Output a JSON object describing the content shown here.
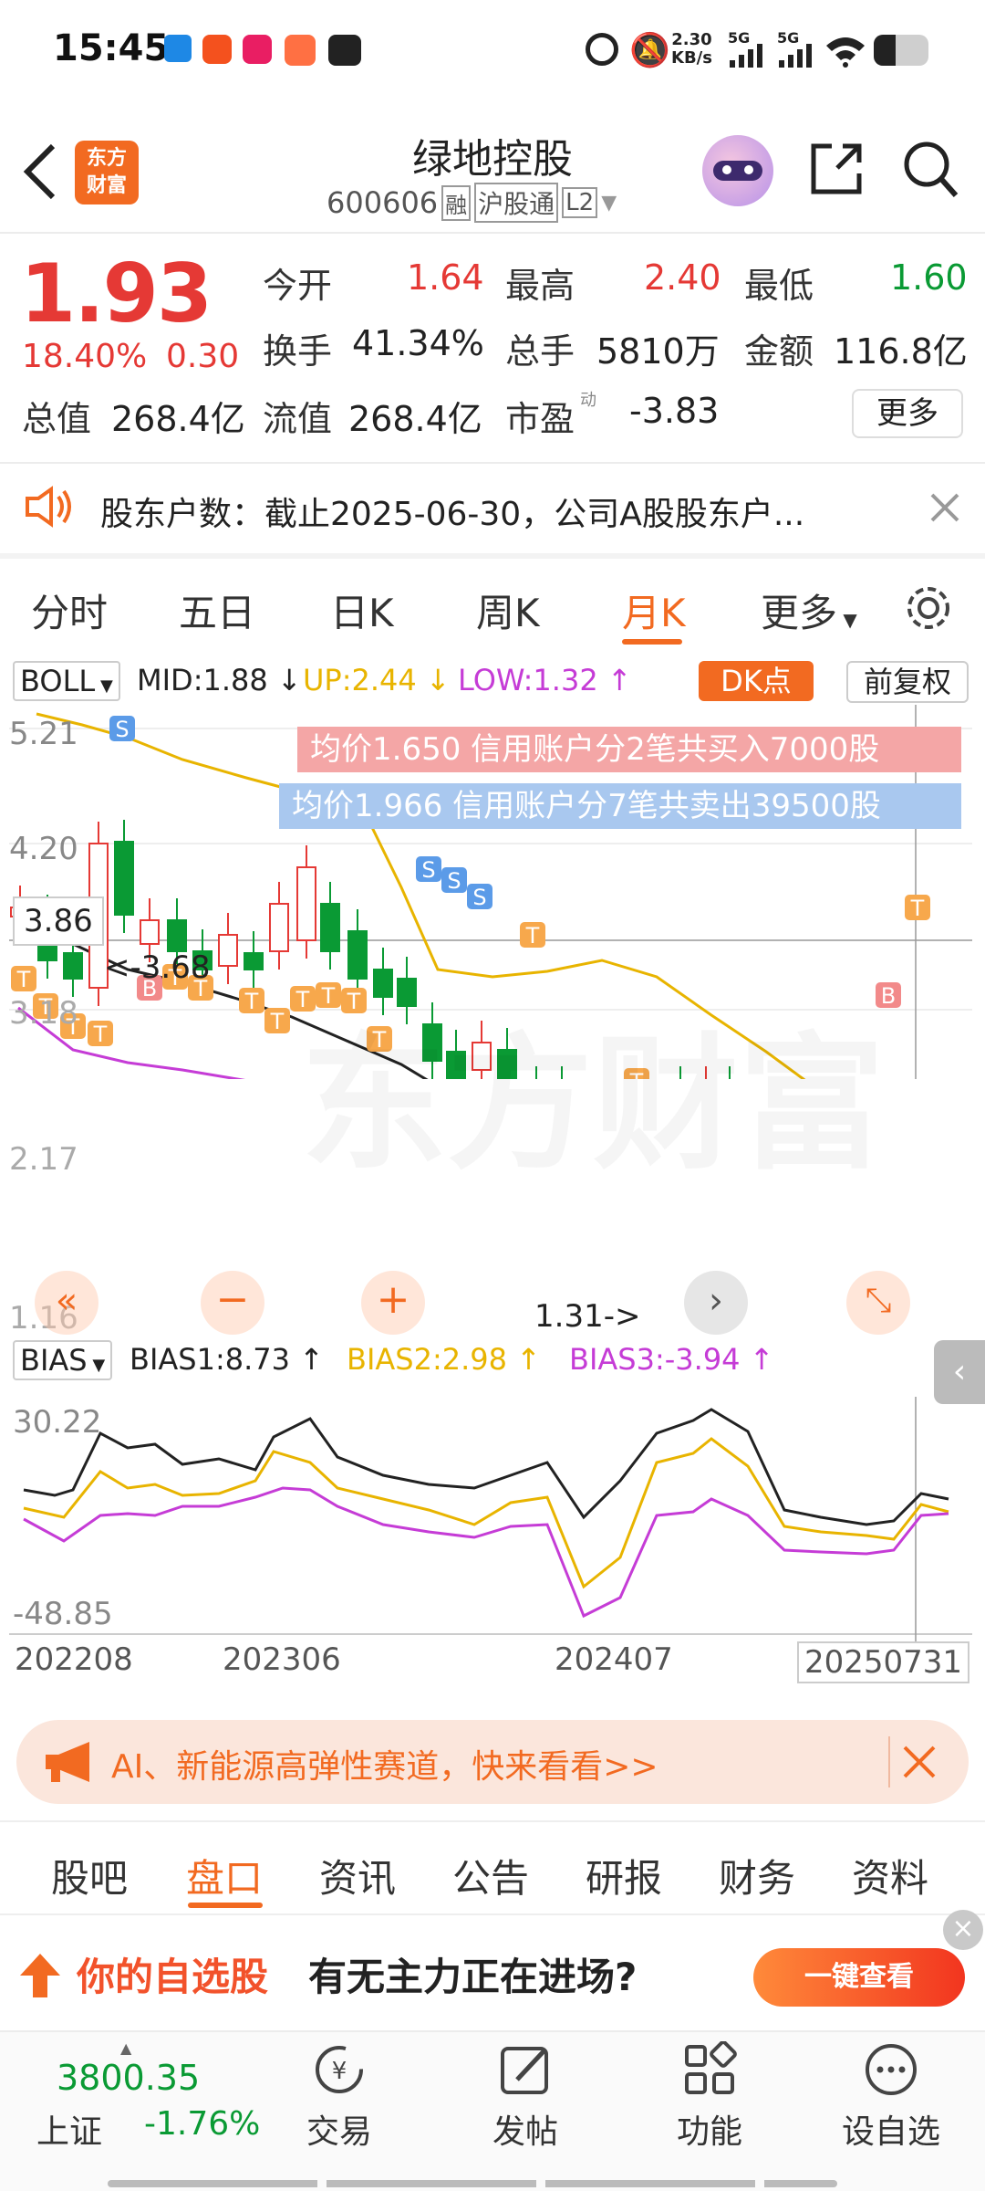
{
  "status": {
    "time": "15:45",
    "net_speed_top": "2.30",
    "net_speed_unit": "KB/s",
    "sig1": "5G",
    "sig2": "5G"
  },
  "header": {
    "title": "绿地控股",
    "code": "600606",
    "badge_rong": "融",
    "badge_hgt": "沪股通",
    "badge_l2": "L2",
    "logo_line1": "东方",
    "logo_line2": "财富"
  },
  "quote": {
    "price": "1.93",
    "change_pct": "18.40%",
    "change_amt": "0.30",
    "open_label": "今开",
    "open": "1.64",
    "high_label": "最高",
    "high": "2.40",
    "low_label": "最低",
    "low": "1.60",
    "turnover_label": "换手",
    "turnover": "41.34%",
    "volume_label": "总手",
    "volume": "5810万",
    "amount_label": "金额",
    "amount": "116.8亿",
    "mcap_label": "总值",
    "mcap": "268.4亿",
    "float_label": "流值",
    "float": "268.4亿",
    "pe_label": "市盈",
    "pe_sup": "动",
    "pe": "-3.83",
    "more": "更多"
  },
  "notice": {
    "text": "股东户数：截止2025-06-30，公司A股股东户..."
  },
  "chart_tabs": [
    {
      "label": "分时"
    },
    {
      "label": "五日"
    },
    {
      "label": "日K"
    },
    {
      "label": "周K"
    },
    {
      "label": "月K"
    },
    {
      "label": "更多"
    }
  ],
  "indicator": {
    "boll": "BOLL",
    "mid": "MID:1.88",
    "up": "UP:2.44",
    "low": "LOW:1.32",
    "dk": "DK点",
    "fq": "前复权",
    "trade_buy": "均价1.650  信用账户分2笔共买入7000股",
    "trade_sell": "均价1.966  信用账户分7笔共卖出39500股",
    "y_top": "5.21",
    "y2": "4.20",
    "y_cross": "3.86",
    "y3": "3.18",
    "y4": "2.17",
    "y_bot": "1.16",
    "note_high": "<-3.68",
    "note_low": "1.31->",
    "watermark": "东方财富"
  },
  "bias": {
    "name": "BIAS",
    "b1": "BIAS1:8.73",
    "b2": "BIAS2:2.98",
    "b3": "BIAS3:-3.94",
    "y_top": "30.22",
    "y_bot": "-48.85",
    "x_labels": [
      "202208",
      "202306",
      "202407",
      "20250731"
    ]
  },
  "ad": {
    "text": "AI、新能源高弹性赛道，快来看看>>"
  },
  "sub_tabs": [
    {
      "label": "股吧"
    },
    {
      "label": "盘口"
    },
    {
      "label": "资讯"
    },
    {
      "label": "公告"
    },
    {
      "label": "研报"
    },
    {
      "label": "财务"
    },
    {
      "label": "资料"
    }
  ],
  "promo": {
    "part1": "你的自选股",
    "part2": "有无主力正在进场?",
    "button": "一键查看"
  },
  "bottom": {
    "index_value": "3800.35",
    "index_name": "上证",
    "index_change": "-1.76%",
    "items": [
      {
        "label": "交易"
      },
      {
        "label": "发帖"
      },
      {
        "label": "功能"
      },
      {
        "label": "设自选"
      }
    ]
  },
  "colors": {
    "up": "#e53935",
    "down": "#0a9a34",
    "accent": "#f26a21",
    "mid": "#222222",
    "upper": "#e8b400",
    "lower": "#c53cd6"
  }
}
